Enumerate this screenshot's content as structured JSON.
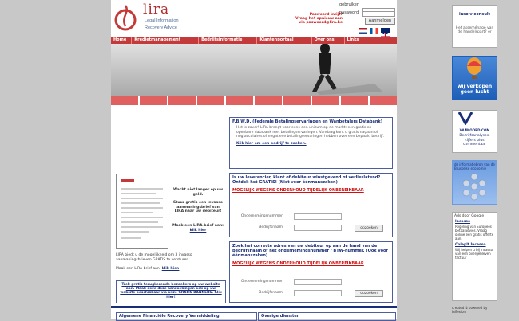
{
  "header": {
    "logo_title": "lira",
    "logo_line1": "Legal Information",
    "logo_line2": "Recovery Advice",
    "forgot_line1": "Paswoord kwijt?",
    "forgot_line2": "Vraag het opnieuw aan",
    "forgot_line3": "via paswoord@lira.be",
    "user_label": "gebruiker",
    "password_label": "paswoord",
    "login_button": "Aanmelden"
  },
  "nav": {
    "items": [
      "Home",
      "Kredietmanagement",
      "Bedrijfsinformatie",
      "Klantenportaal",
      "Over ons",
      "Links"
    ]
  },
  "fbwd": {
    "title": "F.B.W.D. (Federale Betalingservaringen en Wanbetalers Databank)",
    "body": "Het is zover! LIRA brengt voor eens een unicum op de markt: een gratis en openbare databank met betalingservaringen. Vandaag kunt u gratis nagaan of nog accolaires of negatieve betalingservaringen hebben over een bepaald bedrijf.",
    "link": "Klik hier om een bedrijf te zoeken."
  },
  "letter": {
    "text1": "Wacht niet langer op uw geld.",
    "text2": "Stuur gratis een invasso aanmaningsbrief van LIRA naar uw debiteur!",
    "text3": "Maak een LIRA-brief aan:",
    "link": "klik hier",
    "note": "LIRA biedt u de mogelijkheid om 3 invasso aanmaningsbrieven GRATIS te versturen.",
    "note2": "Maak een LIRA-brief aan:",
    "note2_link": "klik hier."
  },
  "form1": {
    "title": "Is uw leverancier, klant of debiteur winstgevend of verlieslatend? Ontdek het GRATIS! (Niet voor éénmanszaken)",
    "warning": "MOGELIJK WEGENS ONDERHOUD TIJDELIJK ONBEREIKBAAR",
    "label1": "Ondernemingsnummer",
    "label2": "Bedrijfsnaam",
    "button": "opzoeken"
  },
  "form2": {
    "title": "Zoek het correcte adres van uw debiteur op aan de hand van de bedrijfsnaam of het ondernemingsnummer / BTW-nummer. (Ook voor éénmanszaken)",
    "warning": "MOGELIJK WEGENS ONDERHOUD TIJDELIJK ONBEREIKBAAR",
    "label1": "Ondernemingsnummer",
    "label2": "Bedrijfsnaam",
    "button": "opzoeken"
  },
  "promo": {
    "text": "Trek gratis terugkerende bezoekers op uw website aan. Maak deze deze aanzoekingen ook op uw website beschikbaar via onze GRATIS BANNERS. Klik hier!"
  },
  "footer": {
    "col1": "Algemene Financiële Recovery Vermiddeling",
    "col2": "Overige diensten"
  },
  "sidebar": {
    "ad1_brand": "insolv consult",
    "ad1_caption": "Het asseménage van de handelspart? er",
    "ad2_caption": "wij verkopen geen lucht",
    "ad3_brand": "VANNOORD.COM",
    "ad3_caption": "Bedrijfsanalyses, cijfers plus commentaar",
    "ad4_caption": "de informatiebron van de Brusselse economie",
    "ads_by": "Ads door Google",
    "google_ad1_title": "Incasso",
    "google_ad1_body": "Regeling van Europees betaaladvies. Vraag online een gratis offerte aan.",
    "google_ad2_title": "Coleplt Incasso",
    "google_ad2_body": "Wij helpen u bij incasso van een overgebleven factuur",
    "created": "created & powered by Inflexion"
  }
}
